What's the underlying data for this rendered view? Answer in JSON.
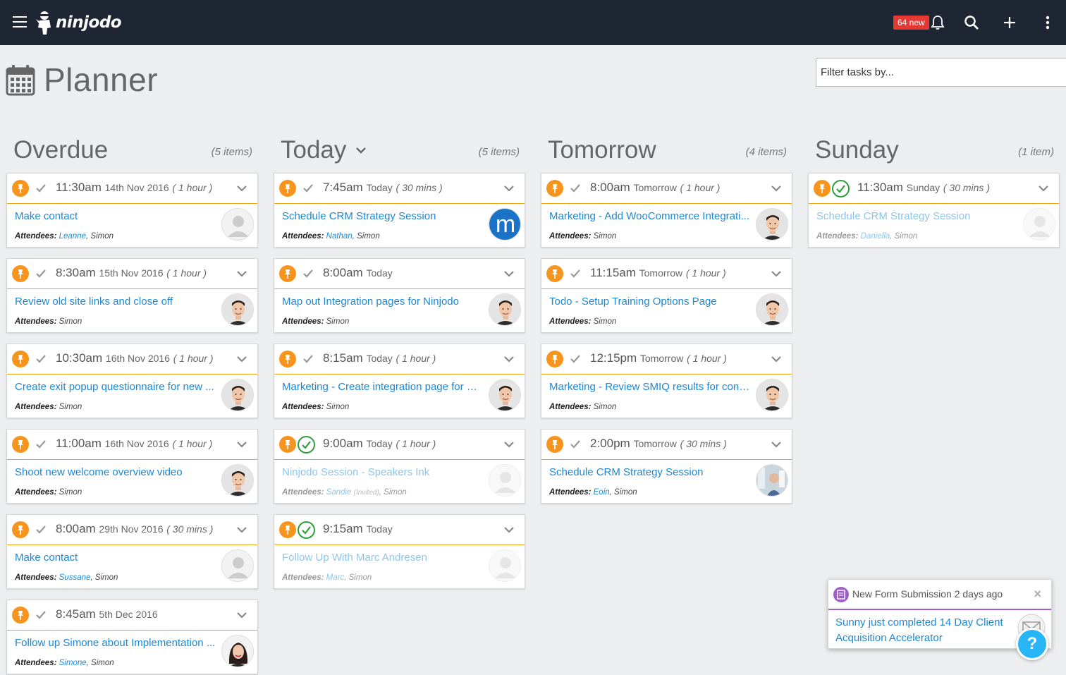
{
  "app": {
    "logo_text": "ninjodo",
    "notifications_badge": "64 new"
  },
  "page": {
    "title": "Planner",
    "filter_placeholder": "Filter tasks by..."
  },
  "columns": [
    {
      "title": "Overdue",
      "count": "(5 items)",
      "dropdown": false,
      "cards": [
        {
          "time": "11:30am",
          "day": "14th Nov 2016",
          "dur": "( 1 hour )",
          "done": false,
          "title": "Make contact",
          "attendees_prefix": "Attendees:",
          "attendee_link": "Leanne",
          "attendee_rest": ", Simon",
          "invited": "",
          "avatar": "placeholder"
        },
        {
          "time": "8:30am",
          "day": "15th Nov 2016",
          "dur": "( 1 hour )",
          "done": false,
          "title": "Review old site links and close off",
          "attendees_prefix": "Attendees:",
          "attendee_link": "",
          "attendee_rest": "Simon",
          "invited": "",
          "avatar": "man"
        },
        {
          "time": "10:30am",
          "day": "16th Nov 2016",
          "dur": "( 1 hour )",
          "done": false,
          "title": "Create exit popup questionnaire for new ...",
          "attendees_prefix": "Attendees:",
          "attendee_link": "",
          "attendee_rest": "Simon",
          "invited": "",
          "avatar": "man"
        },
        {
          "time": "11:00am",
          "day": "16th Nov 2016",
          "dur": "( 1 hour )",
          "done": false,
          "title": "Shoot new welcome overview video",
          "attendees_prefix": "Attendees:",
          "attendee_link": "",
          "attendee_rest": "Simon",
          "invited": "",
          "avatar": "man"
        },
        {
          "time": "8:00am",
          "day": "29th Nov 2016",
          "dur": "( 30 mins )",
          "done": false,
          "title": "Make contact",
          "attendees_prefix": "Attendees:",
          "attendee_link": "Sussane",
          "attendee_rest": ", Simon",
          "invited": "",
          "avatar": "placeholder"
        },
        {
          "time": "8:45am",
          "day": "5th Dec 2016",
          "dur": "",
          "done": false,
          "title": "Follow up Simone about Implementation ...",
          "attendees_prefix": "Attendees:",
          "attendee_link": "Simone",
          "attendee_rest": ", Simon",
          "invited": "",
          "avatar": "woman"
        }
      ]
    },
    {
      "title": "Today",
      "count": "(5 items)",
      "dropdown": true,
      "cards": [
        {
          "time": "7:45am",
          "day": "Today",
          "dur": "( 30 mins )",
          "done": false,
          "title": "Schedule CRM Strategy Session",
          "attendees_prefix": "Attendees:",
          "attendee_link": "Nathan",
          "attendee_rest": ", Simon",
          "invited": "",
          "avatar": "m-logo"
        },
        {
          "time": "8:00am",
          "day": "Today",
          "dur": "",
          "done": false,
          "title": "Map out Integration pages for Ninjodo",
          "attendees_prefix": "Attendees:",
          "attendee_link": "",
          "attendee_rest": "Simon",
          "invited": "",
          "avatar": "man"
        },
        {
          "time": "8:15am",
          "day": "Today",
          "dur": "( 1 hour )",
          "done": false,
          "title": "Marketing - Create integration page for G...",
          "attendees_prefix": "Attendees:",
          "attendee_link": "",
          "attendee_rest": "Simon",
          "invited": "",
          "avatar": "man"
        },
        {
          "time": "9:00am",
          "day": "Today",
          "dur": "( 1 hour )",
          "done": true,
          "title": "Ninjodo Session - Speakers Ink",
          "attendees_prefix": "Attendees:",
          "attendee_link": "Sandie",
          "attendee_rest": ", Simon",
          "invited": "(Invited)",
          "avatar": "placeholder"
        },
        {
          "time": "9:15am",
          "day": "Today",
          "dur": "",
          "done": true,
          "title": "Follow Up With Marc Andresen",
          "attendees_prefix": "Attendees:",
          "attendee_link": "Marc",
          "attendee_rest": ", Simon",
          "invited": "",
          "avatar": "placeholder"
        }
      ]
    },
    {
      "title": "Tomorrow",
      "count": "(4 items)",
      "dropdown": false,
      "cards": [
        {
          "time": "8:00am",
          "day": "Tomorrow",
          "dur": "( 1 hour )",
          "done": false,
          "title": "Marketing - Add WooCommerce Integrati...",
          "attendees_prefix": "Attendees:",
          "attendee_link": "",
          "attendee_rest": "Simon",
          "invited": "",
          "avatar": "man"
        },
        {
          "time": "11:15am",
          "day": "Tomorrow",
          "dur": "( 1 hour )",
          "done": false,
          "title": "Todo - Setup Training Options Page",
          "attendees_prefix": "Attendees:",
          "attendee_link": "",
          "attendee_rest": "Simon",
          "invited": "",
          "avatar": "man"
        },
        {
          "time": "12:15pm",
          "day": "Tomorrow",
          "dur": "( 1 hour )",
          "done": false,
          "title": "Marketing - Review SMIQ results for cont...",
          "attendees_prefix": "Attendees:",
          "attendee_link": "",
          "attendee_rest": "Simon",
          "invited": "",
          "avatar": "man"
        },
        {
          "time": "2:00pm",
          "day": "Tomorrow",
          "dur": "( 30 mins )",
          "done": false,
          "title": "Schedule CRM Strategy Session",
          "attendees_prefix": "Attendees:",
          "attendee_link": "Eoin",
          "attendee_rest": ", Simon",
          "invited": "",
          "avatar": "photo"
        }
      ]
    },
    {
      "title": "Sunday",
      "count": "(1 item)",
      "dropdown": false,
      "cards": [
        {
          "time": "11:30am",
          "day": "Sunday",
          "dur": "( 30 mins )",
          "done": true,
          "title": "Schedule CRM Strategy Session",
          "attendees_prefix": "Attendees:",
          "attendee_link": "Daniella",
          "attendee_rest": ", Simon",
          "invited": "",
          "avatar": "placeholder"
        }
      ]
    }
  ],
  "notification": {
    "title": "New Form Submission 2 days ago",
    "close": "×",
    "body": "Sunny just completed 14 Day Client Acquisition Accelerator"
  },
  "help": {
    "label": "?"
  },
  "colors": {
    "accent": "#f7941d",
    "link": "#1e88d1",
    "topbar": "#1e2633",
    "done": "#2e9e3f",
    "notif": "#a05fc5"
  }
}
